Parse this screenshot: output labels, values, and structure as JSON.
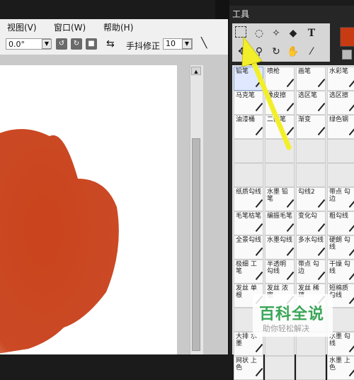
{
  "menu": {
    "view": "视图(V)",
    "window": "窗口(W)",
    "help": "帮助(H)"
  },
  "toolbar": {
    "angle": "0.0°",
    "stabilizer_label": "手抖修正",
    "stabilizer_value": "10"
  },
  "panel": {
    "title": "工具",
    "primary_color": "#c83a12"
  },
  "brushes": [
    "铅笔",
    "喷枪",
    "画笔",
    "水彩笔",
    "马克笔",
    "橡皮擦",
    "选区笔",
    "选区擦",
    "油漆桶",
    "二值笔",
    "渐变",
    "绿色钢",
    "",
    "",
    "",
    "",
    "",
    "",
    "",
    "",
    "纸质勾线",
    "水墨 铅笔",
    "勾线2",
    "带点 勾边",
    "毛笔枯笔",
    "编振毛笔",
    "变化勾",
    "粗勾线",
    "全景勾线",
    "水墨勾线",
    "多水勾线",
    "硬朗 勾线",
    "极细 工笔",
    "半透明 勾线",
    "带点 勾边",
    "干燥 勾线",
    "发丝 单根",
    "发丝 浓密",
    "发丝 稀疏",
    "短棉质 勾线",
    "",
    "",
    "",
    "",
    "大排 水墨",
    "",
    "",
    "水墨 勾线",
    "网状 上色",
    "",
    "",
    "水墨 上色"
  ],
  "watermark": {
    "title": "百科全说",
    "subtitle": "助你轻松解决"
  }
}
